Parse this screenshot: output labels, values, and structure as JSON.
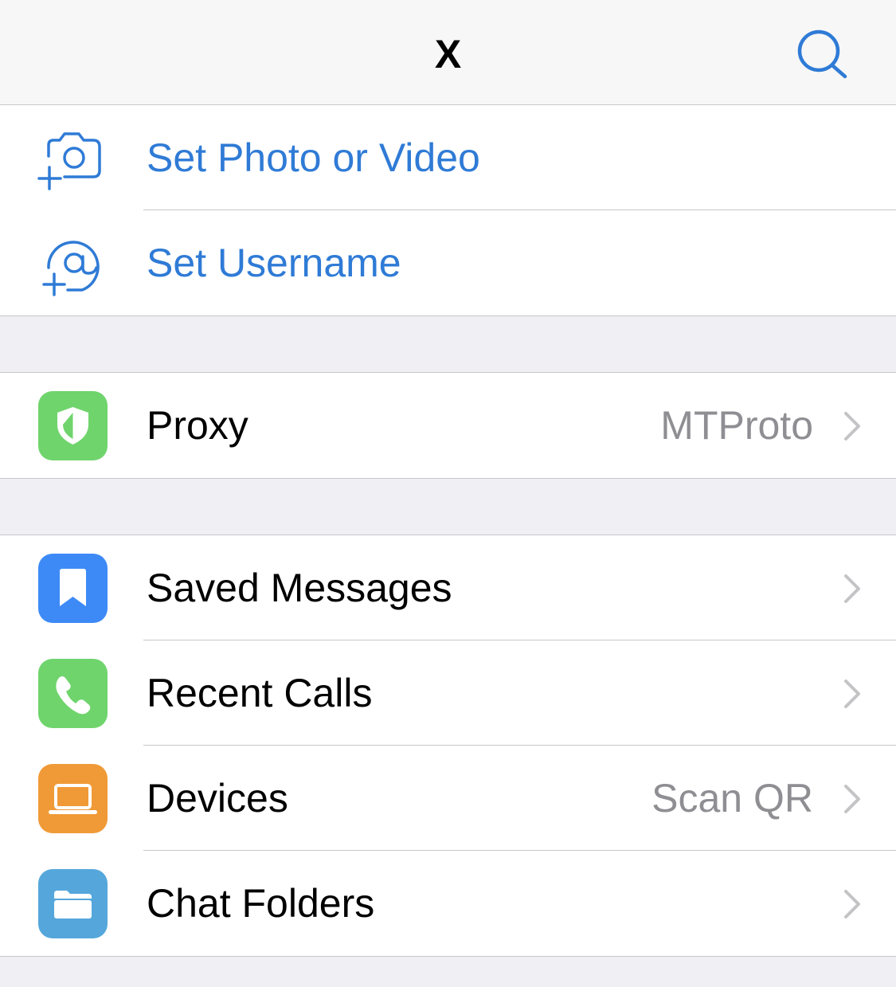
{
  "header": {
    "title": "X"
  },
  "account_section": {
    "items": [
      {
        "label": "Set Photo or Video",
        "icon": "camera-add-icon"
      },
      {
        "label": "Set Username",
        "icon": "at-add-icon"
      }
    ]
  },
  "proxy_section": {
    "items": [
      {
        "label": "Proxy",
        "value": "MTProto",
        "icon": "shield-icon",
        "icon_color": "#6fd46c"
      }
    ]
  },
  "main_section": {
    "items": [
      {
        "label": "Saved Messages",
        "value": "",
        "icon": "bookmark-icon",
        "icon_color": "#3d8af7"
      },
      {
        "label": "Recent Calls",
        "value": "",
        "icon": "phone-icon",
        "icon_color": "#6fd46c"
      },
      {
        "label": "Devices",
        "value": "Scan QR",
        "icon": "laptop-icon",
        "icon_color": "#f09a37"
      },
      {
        "label": "Chat Folders",
        "value": "",
        "icon": "folder-icon",
        "icon_color": "#55a7db"
      }
    ]
  },
  "colors": {
    "accent": "#2f7bd6",
    "secondary_text": "#8e8e93",
    "background": "#efeff4"
  }
}
